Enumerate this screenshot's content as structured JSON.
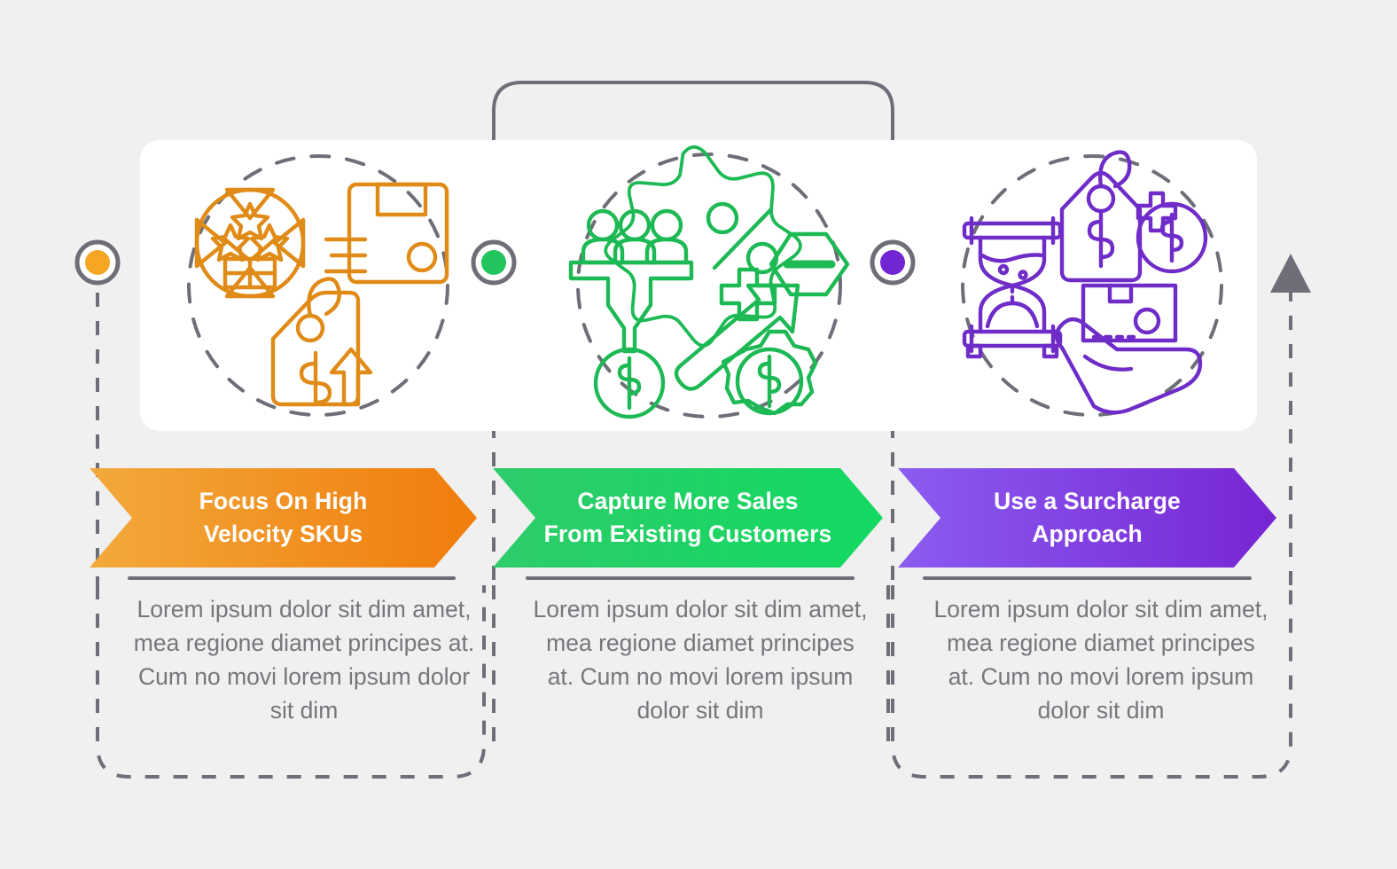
{
  "palette": {
    "background": "#f0f0f0",
    "card": "#ffffff",
    "line_gray": "#6e6e78",
    "text_gray": "#76767c",
    "step1_light": "#f2a93c",
    "step1_dark": "#f07c0b",
    "step2_light": "#2ecc6a",
    "step2_dark": "#12d961",
    "step3_light": "#8b5cf0",
    "step3_dark": "#7725d4"
  },
  "steps": [
    {
      "index": 1,
      "title": "Focus On High\nVelocity SKUs",
      "title_line1": "Focus On High",
      "title_line2": "Velocity SKUs",
      "description": "Lorem ipsum dolor sit dim amet, mea regione diamet principes at. Cum no movi lorem ipsum dolor sit dim",
      "accent": "#f07c0b",
      "marker": "step-marker-orange",
      "icons": [
        "stars-box-arrows-icon",
        "shipping-package-icon",
        "price-tag-up-arrow-icon"
      ]
    },
    {
      "index": 2,
      "title": "Capture More Sales\nFrom Existing Customers",
      "title_line1": "Capture More Sales",
      "title_line2": "From Existing Customers",
      "description": "Lorem ipsum dolor sit dim amet, mea regione diamet principes at. Cum no movi lorem ipsum dolor sit dim",
      "accent": "#12d961",
      "marker": "step-marker-green",
      "icons": [
        "sales-funnel-people-icon",
        "percent-star-discount-icon",
        "growth-arrow-dollar-gear-icon"
      ]
    },
    {
      "index": 3,
      "title": "Use a Surcharge\nApproach",
      "title_line1": "Use a Surcharge",
      "title_line2": "Approach",
      "description": "Lorem ipsum dolor sit dim amet, mea regione diamet principes at. Cum no movi lorem ipsum dolor sit dim",
      "accent": "#7725d4",
      "marker": "step-marker-purple",
      "icons": [
        "hourglass-icon",
        "price-tag-dollar-plus-coin-icon",
        "hand-holding-package-icon"
      ]
    }
  ],
  "connectors": {
    "start_marker": "circle-marker-orange",
    "end_marker": "arrowhead-up-icon",
    "style": "dashed-gray"
  }
}
